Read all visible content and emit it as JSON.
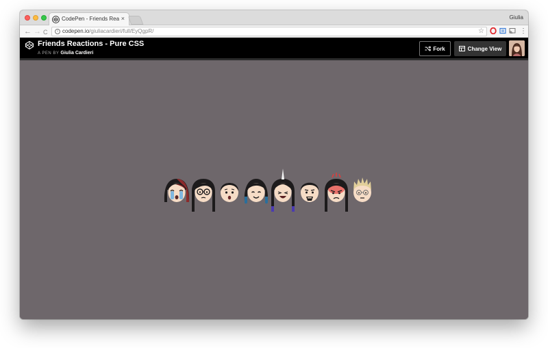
{
  "browser": {
    "tab_title": "CodePen - Friends Reactions",
    "tab_close": "×",
    "profile_name": "Giulia",
    "url_host": "codepen.io",
    "url_path": "/giuliacardieri/full/EyQgpR/",
    "nav": {
      "back": "←",
      "forward": "→",
      "reload": "C"
    },
    "star": "☆"
  },
  "header": {
    "title": "Friends Reactions - Pure CSS",
    "by_label": "A PEN BY",
    "author": "Giulia Cardieri",
    "fork_label": "Fork",
    "change_view_label": "Change View"
  },
  "colors": {
    "stage_background": "#6e676b",
    "header_background": "#000000",
    "skin": "#f6dcc6"
  },
  "faces": [
    {
      "name": "crying",
      "hair": "black-red"
    },
    {
      "name": "glasses",
      "hair": "black"
    },
    {
      "name": "surprised",
      "hair": "black-short"
    },
    {
      "name": "smile",
      "hair": "black-blue-tips"
    },
    {
      "name": "unicorn-laugh",
      "hair": "black-purple-tips"
    },
    {
      "name": "goatee",
      "hair": "black-short"
    },
    {
      "name": "angry",
      "hair": "black"
    },
    {
      "name": "blonde-spiky",
      "hair": "blonde"
    }
  ]
}
